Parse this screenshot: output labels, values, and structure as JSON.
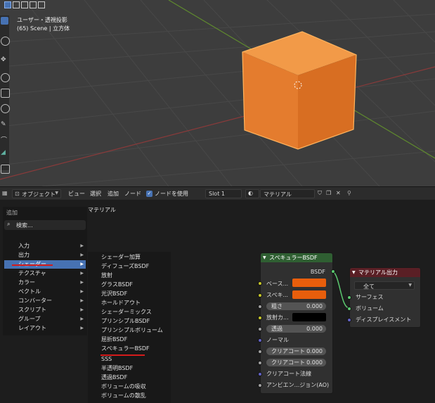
{
  "viewport": {
    "title": "ユーザー・透視投影",
    "subtitle": "(65) Scene | 立方体"
  },
  "header": {
    "mode": "オブジェクト",
    "menu": [
      "ビュー",
      "選択",
      "追加",
      "ノード"
    ],
    "use_nodes_label": "ノードを使用",
    "use_nodes_checked": true,
    "slot": "Slot 1",
    "material": "マテリアル"
  },
  "editor": {
    "breadcrumb": "マテリアル"
  },
  "add_menu": {
    "title": "追加",
    "search_placeholder": "検索...",
    "items": [
      "入力",
      "出力",
      "シェーダー",
      "テクスチャ",
      "カラー",
      "ベクトル",
      "コンバーター",
      "スクリプト",
      "グループ",
      "レイアウト"
    ],
    "highlighted": "シェーダー"
  },
  "shader_submenu": {
    "items": [
      "シェーダー加算",
      "ディフューズBSDF",
      "放射",
      "グラスBSDF",
      "光沢BSDF",
      "ホールドアウト",
      "シェーダーミックス",
      "プリンシプルBSDF",
      "プリンシプルボリューム",
      "屈折BSDF",
      "スペキュラーBSDF",
      "SSS",
      "半透明BSDF",
      "透過BSDF",
      "ボリュームの吸収",
      "ボリュームの散乱"
    ],
    "underlined": "スペキュラーBSDF"
  },
  "specular_node": {
    "title": "スペキュラーBSDF",
    "output": "BSDF",
    "base_color_label": "ベース...",
    "specular_label": "スペキ...",
    "roughness_label": "粗さ",
    "roughness_value": "0.000",
    "emission_label": "放射カ...",
    "transparency_label": "透過",
    "transparency_value": "0.000",
    "normal_label": "ノーマル",
    "clearcoat_label": "クリアコート",
    "clearcoat_value": "0.000",
    "clearcoat_rough_label": "クリアコート",
    "clearcoat_rough_value": "0.000",
    "clearcoat_normal_label": "クリアコート法線",
    "ao_label": "アンビエン...ジョン(AO)",
    "colors": {
      "header": "#2f5f32",
      "base_color": "#e85e0c",
      "emission": "#000000"
    }
  },
  "output_node": {
    "title": "マテリアル出力",
    "target": "全て",
    "surface_label": "サーフェス",
    "volume_label": "ボリューム",
    "displacement_label": "ディスプレイスメント",
    "colors": {
      "header": "#5a1f25"
    }
  },
  "colors": {
    "cube": "#e47c2e",
    "accent": "#4772b3",
    "annotation": "#d51b1b",
    "link": "#5bc86f"
  }
}
